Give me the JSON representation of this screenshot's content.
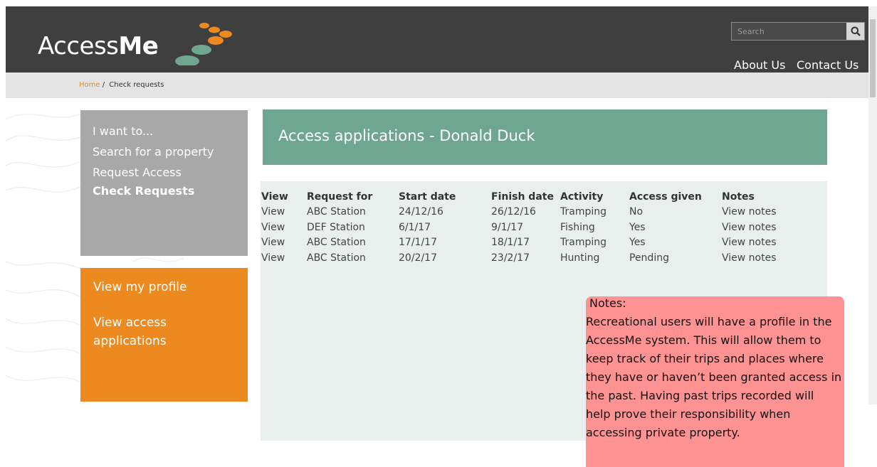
{
  "app": {
    "name_light": "Access",
    "name_bold": "Me"
  },
  "header": {
    "search_placeholder": "Search",
    "nav": [
      "About Us",
      "Contact Us"
    ]
  },
  "breadcrumb": {
    "home": "Home",
    "separator": "/",
    "current": "Check requests"
  },
  "sidebar": {
    "heading": "I want to...",
    "links": [
      "Search for a property",
      "Request Access",
      "Check Requests"
    ],
    "profile_links": [
      "View my profile",
      "View access applications"
    ]
  },
  "main": {
    "title": "Access applications - Donald Duck",
    "table": {
      "headers": [
        "View",
        "Request for",
        "Start date",
        "Finish date",
        "Activity",
        "Access given",
        "Notes"
      ],
      "rows": [
        [
          "View",
          "ABC Station",
          "24/12/16",
          "26/12/16",
          "Tramping",
          "No",
          "View notes"
        ],
        [
          "View",
          "DEF Station",
          "6/1/17",
          "9/1/17",
          "Fishing",
          "Yes",
          "View notes"
        ],
        [
          "View",
          "ABC Station",
          "17/1/17",
          "18/1/17",
          "Tramping",
          "Yes",
          "View notes"
        ],
        [
          "View",
          "ABC Station",
          "20/2/17",
          "23/2/17",
          "Hunting",
          "Pending",
          "View notes"
        ]
      ]
    }
  },
  "notes": {
    "title": "Notes:",
    "body": "Recreational users will have a profile in the AccessMe system. This will allow them to keep track of their trips and places where they have or haven’t been granted access in the past. Having past trips recorded will help prove their responsibility when accessing private property."
  },
  "colors": {
    "header": "#3f3f3f",
    "accent_orange": "#ec8a1f",
    "title_green": "#6fa692",
    "notes_pink": "#ff9393"
  },
  "icons": [
    "search-icon",
    "logo-dots-icon"
  ]
}
